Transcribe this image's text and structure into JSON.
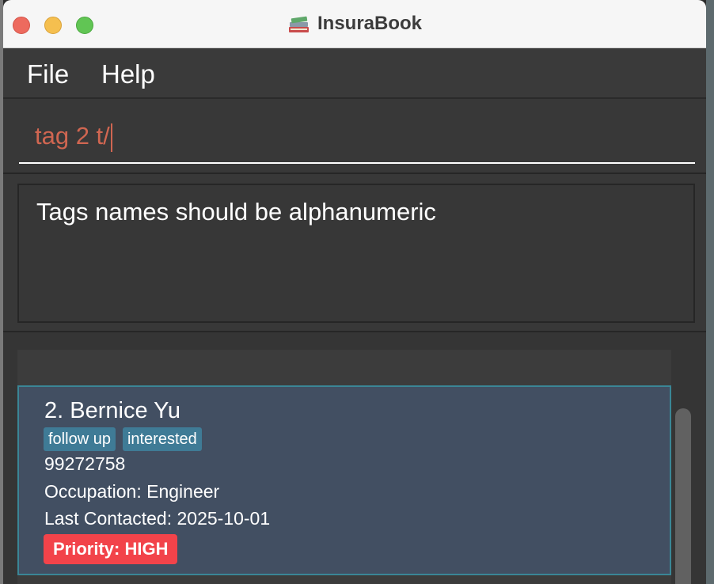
{
  "window": {
    "title": "InsuraBook",
    "app_icon": "books-icon"
  },
  "menu": {
    "file": "File",
    "help": "Help"
  },
  "command": {
    "value": "tag 2 t/"
  },
  "result": {
    "message": "Tags names should be alphanumeric"
  },
  "persons": [
    {
      "name": "2. Bernice Yu",
      "tags": [
        "follow up",
        "interested"
      ],
      "phone": "99272758",
      "occupation": "Occupation: Engineer",
      "last_contacted": "Last Contacted: 2025-10-01",
      "priority": "Priority: HIGH"
    }
  ],
  "colors": {
    "accent": "#3a8696",
    "tag": "#3f7b96",
    "priority_high": "#f2434a",
    "command_text": "#d06651"
  }
}
